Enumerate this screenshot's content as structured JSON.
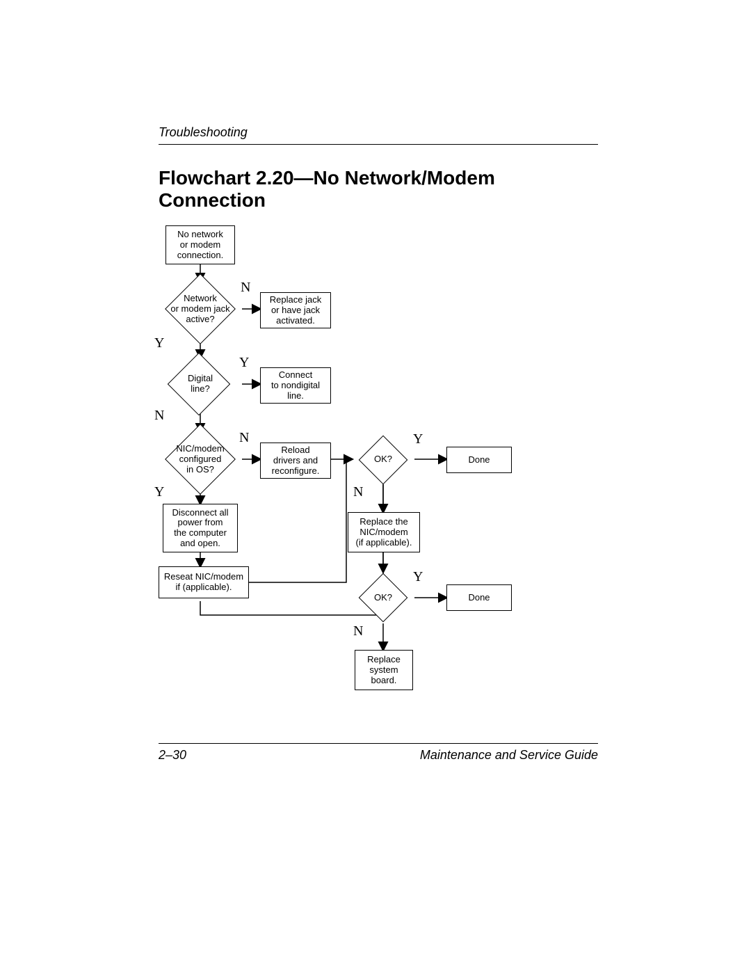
{
  "header": {
    "section": "Troubleshooting"
  },
  "title": "Flowchart 2.20—No Network/Modem Connection",
  "nodes": {
    "start": "No network\nor modem\nconnection.",
    "jack_active": "Network\nor modem jack\nactive?",
    "replace_jack": "Replace jack\nor have jack\nactivated.",
    "digital_line": "Digital\nline?",
    "connect_nondigital": "Connect\nto nondigital\nline.",
    "configured": "NIC/modem\nconfigured\nin OS?",
    "reload_drivers": "Reload\ndrivers and\nreconfigure.",
    "ok1": "OK?",
    "done1": "Done",
    "disconnect": "Disconnect all\npower from\nthe computer\nand open.",
    "reseat": "Reseat NIC/modem\nif (applicable).",
    "replace_nic": "Replace the\nNIC/modem\n(if applicable).",
    "ok2": "OK?",
    "done2": "Done",
    "replace_board": "Replace\nsystem\nboard."
  },
  "labels": {
    "Y": "Y",
    "N": "N"
  },
  "footer": {
    "page": "2–30",
    "book": "Maintenance and Service Guide"
  },
  "chart_data": {
    "type": "flowchart",
    "title": "Flowchart 2.20—No Network/Modem Connection",
    "nodes": [
      {
        "id": "start",
        "shape": "rect",
        "text": "No network or modem connection."
      },
      {
        "id": "jack_active",
        "shape": "diamond",
        "text": "Network or modem jack active?"
      },
      {
        "id": "replace_jack",
        "shape": "rect",
        "text": "Replace jack or have jack activated."
      },
      {
        "id": "digital_line",
        "shape": "diamond",
        "text": "Digital line?"
      },
      {
        "id": "connect_nondigital",
        "shape": "rect",
        "text": "Connect to nondigital line."
      },
      {
        "id": "configured",
        "shape": "diamond",
        "text": "NIC/modem configured in OS?"
      },
      {
        "id": "reload_drivers",
        "shape": "rect",
        "text": "Reload drivers and reconfigure."
      },
      {
        "id": "ok1",
        "shape": "diamond",
        "text": "OK?"
      },
      {
        "id": "done1",
        "shape": "rect",
        "text": "Done"
      },
      {
        "id": "disconnect",
        "shape": "rect",
        "text": "Disconnect all power from the computer and open."
      },
      {
        "id": "reseat",
        "shape": "rect",
        "text": "Reseat NIC/modem if (applicable)."
      },
      {
        "id": "replace_nic",
        "shape": "rect",
        "text": "Replace the NIC/modem (if applicable)."
      },
      {
        "id": "ok2",
        "shape": "diamond",
        "text": "OK?"
      },
      {
        "id": "done2",
        "shape": "rect",
        "text": "Done"
      },
      {
        "id": "replace_board",
        "shape": "rect",
        "text": "Replace system board."
      }
    ],
    "edges": [
      {
        "from": "start",
        "to": "jack_active"
      },
      {
        "from": "jack_active",
        "to": "replace_jack",
        "label": "N"
      },
      {
        "from": "jack_active",
        "to": "digital_line",
        "label": "Y"
      },
      {
        "from": "digital_line",
        "to": "connect_nondigital",
        "label": "Y"
      },
      {
        "from": "digital_line",
        "to": "configured",
        "label": "N"
      },
      {
        "from": "configured",
        "to": "reload_drivers",
        "label": "N"
      },
      {
        "from": "configured",
        "to": "disconnect",
        "label": "Y"
      },
      {
        "from": "reload_drivers",
        "to": "ok1"
      },
      {
        "from": "ok1",
        "to": "done1",
        "label": "Y"
      },
      {
        "from": "ok1",
        "to": "replace_nic",
        "label": "N"
      },
      {
        "from": "disconnect",
        "to": "reseat"
      },
      {
        "from": "reseat",
        "to": "ok1"
      },
      {
        "from": "replace_nic",
        "to": "ok2"
      },
      {
        "from": "ok2",
        "to": "done2",
        "label": "Y"
      },
      {
        "from": "ok2",
        "to": "replace_board",
        "label": "N"
      }
    ]
  }
}
